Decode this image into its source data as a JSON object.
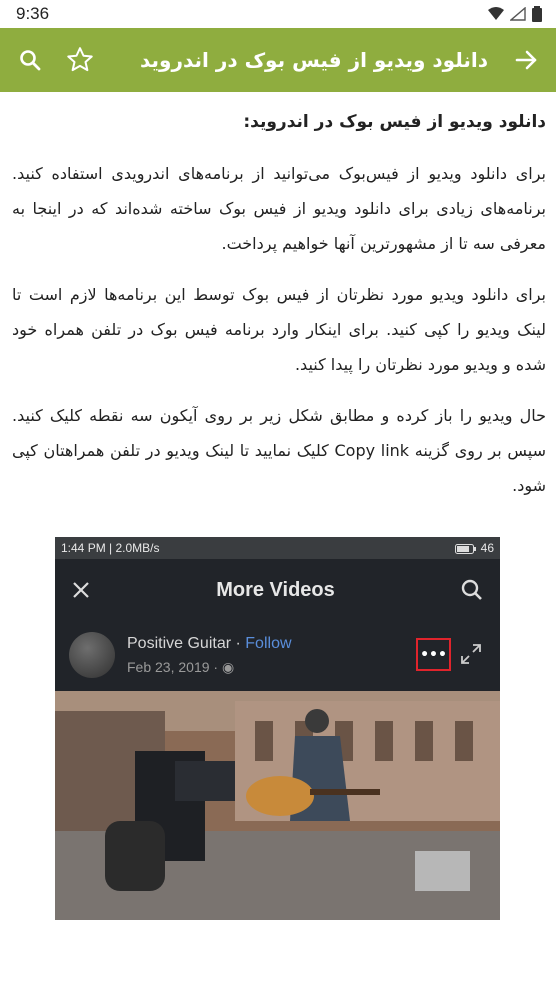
{
  "status_bar": {
    "time": "9:36"
  },
  "app_bar": {
    "title": "دانلود ویدیو از فیس بوک در اندروید",
    "icons": [
      "back-arrow-icon",
      "star-icon",
      "search-icon"
    ]
  },
  "article": {
    "heading": "دانلود ویدیو از فیس بوک در اندروید:",
    "paragraphs": [
      "برای دانلود ویدیو از فیس‌بوک می‌توانید از برنامه‌های اندرویدی استفاده کنید. برنامه‌های زیادی برای دانلود ویدیو از فیس بوک ساخته شده‌اند که در اینجا به معرفی سه تا از مشهورترین آنها خواهیم پرداخت.",
      "برای دانلود ویدیو مورد نظرتان از فیس بوک توسط این برنامه‌ها لازم است تا لینک ویدیو را کپی کنید. برای اینکار وارد برنامه فیس بوک در تلفن همراه خود شده و ویدیو مورد نظرتان را پیدا کنید.",
      "حال ویدیو را باز کرده و مطابق شکل زیر بر روی آیکون سه نقطه کلیک کنید. سپس بر روی گزینه Copy link کلیک نمایید تا لینک ویدیو در تلفن همراهتان کپی شود."
    ]
  },
  "embedded_screenshot": {
    "status_left": "1:44 PM | 2.0MB/s",
    "status_right": "46",
    "header_title": "More Videos",
    "post_author": "Positive Guitar",
    "post_follow": "Follow",
    "post_date": "Feb 23, 2019 ·",
    "more_button": "•••",
    "highlight_color": "#e0242c"
  },
  "colors": {
    "app_bar": "#8fad3f",
    "follow_link": "#5a8edb"
  }
}
